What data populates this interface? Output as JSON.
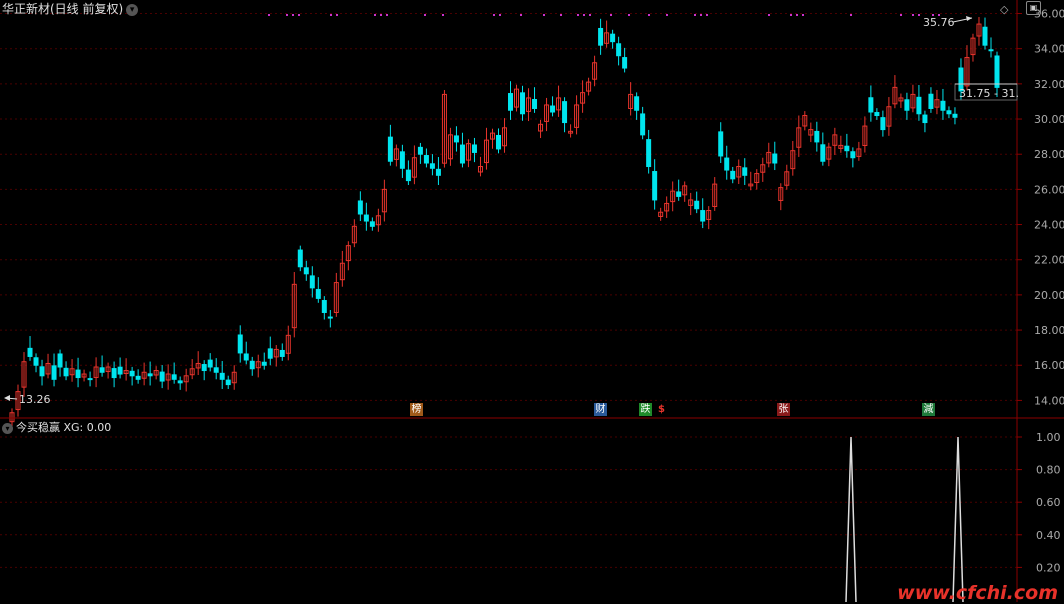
{
  "window": {
    "title": "华正新材(日线 前复权)",
    "dropdown_icon": "chevron-down-icon"
  },
  "main_chart": {
    "y_ticks": [
      "36.00",
      "34.00",
      "32.00",
      "30.00",
      "28.00",
      "26.00",
      "24.00",
      "22.00",
      "20.00",
      "18.00",
      "16.00",
      "14.00"
    ],
    "annotations": {
      "high_label": "35.76",
      "low_label": "13.26",
      "range_label": "31.75 - 31."
    },
    "events": [
      {
        "label": "榜",
        "color": "#a05a1a"
      },
      {
        "label": "财",
        "color": "#2a5a9a"
      },
      {
        "label": "跌",
        "color": "#1f8a2a"
      },
      {
        "label": "$",
        "color": "#000000"
      },
      {
        "label": "张",
        "color": "#8a1a1a"
      },
      {
        "label": "減",
        "color": "#1f7a3a"
      }
    ],
    "colors": {
      "up": "#e8342c",
      "down": "#00e5ee",
      "grid": "#4a0000",
      "axis": "#8b0000",
      "marker": "#cc33cc"
    }
  },
  "indicator": {
    "name": "今买稳赢",
    "value_text": "XG: 0.00",
    "y_ticks": [
      "1.00",
      "0.80",
      "0.60",
      "0.40",
      "0.20"
    ]
  },
  "watermark": "www.cfchi.com",
  "chart_data": {
    "type": "candlestick",
    "y_range": [
      13,
      36.2
    ],
    "series": [
      {
        "name": "price_close_path",
        "values": [
          13.3,
          14.5,
          16.2,
          16.5,
          16.0,
          15.4,
          16.1,
          15.2,
          15.9,
          15.4,
          15.8,
          15.3,
          15.5,
          15.2,
          15.9,
          15.6,
          15.9,
          15.3,
          15.5,
          15.7,
          15.4,
          15.2,
          15.6,
          15.4,
          15.7,
          15.1,
          15.5,
          15.2,
          15.0,
          15.4,
          15.8,
          16.1,
          15.7,
          15.9,
          15.6,
          15.2,
          14.9,
          15.6,
          16.7,
          16.3,
          15.8,
          16.2,
          16.0,
          16.4,
          16.9,
          16.5,
          17.7,
          20.6,
          21.6,
          21.2,
          20.4,
          19.8,
          19.0,
          18.7,
          20.7,
          21.8,
          22.8,
          23.9,
          24.6,
          24.2,
          23.9,
          24.5,
          26.0,
          27.6,
          28.3,
          27.2,
          26.5,
          27.8,
          28.0,
          27.5,
          27.2,
          26.8,
          31.4,
          29.1,
          28.7,
          27.5,
          28.6,
          28.1,
          27.3,
          28.8,
          29.2,
          28.3,
          29.5,
          30.5,
          31.7,
          30.3,
          31.2,
          30.6,
          29.7,
          30.8,
          30.4,
          31.2,
          29.8,
          29.3,
          30.8,
          31.5,
          32.1,
          33.2,
          34.2,
          34.9,
          34.4,
          33.6,
          32.9,
          31.4,
          30.5,
          29.1,
          27.3,
          25.4,
          24.7,
          25.2,
          25.9,
          25.6,
          26.2,
          25.4,
          24.9,
          24.2,
          24.8,
          26.3,
          27.9,
          27.1,
          26.6,
          27.3,
          26.8,
          26.3,
          26.9,
          27.4,
          28.1,
          27.5,
          26.1,
          27.0,
          28.2,
          29.5,
          30.2,
          29.4,
          28.7,
          27.6,
          28.4,
          29.1,
          28.5,
          28.2,
          27.8,
          28.3,
          29.6,
          30.4,
          30.2,
          29.4,
          30.7,
          31.8,
          31.2,
          30.5,
          31.4,
          30.3,
          29.8,
          30.6,
          31.1,
          30.5,
          30.3,
          30.1,
          31.6,
          33.5,
          34.6,
          35.4,
          34.2,
          33.9,
          31.8
        ]
      }
    ],
    "markers": {
      "high": 35.76,
      "low": 13.26
    },
    "indicator_spikes": [
      {
        "name": "XG",
        "value": 1.0
      },
      {
        "name": "XG",
        "value": 1.0
      }
    ]
  }
}
